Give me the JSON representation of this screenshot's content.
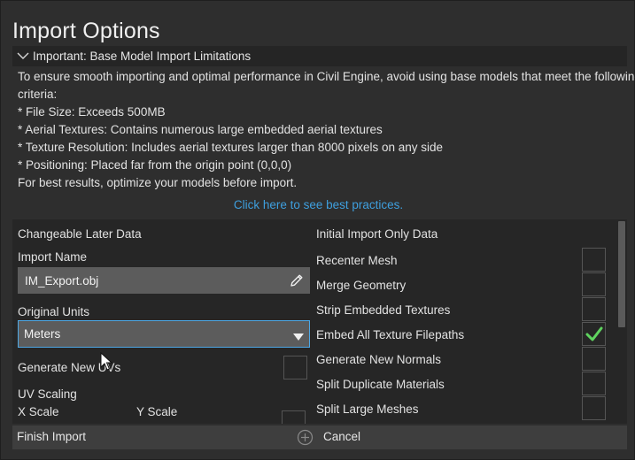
{
  "dialog": {
    "title": "Import Options"
  },
  "notice": {
    "header": "Important: Base Model Import Limitations",
    "lines": [
      "To ensure smooth importing and optimal performance in Civil Engine, avoid using base models that meet the following",
      "criteria:",
      "* File Size: Exceeds 500MB",
      "* Aerial Textures: Contains numerous large embedded aerial textures",
      "* Texture Resolution: Includes aerial textures larger than 8000 pixels on any side",
      "* Positioning: Placed far from the origin point (0,0,0)",
      "For best results, optimize your models before import."
    ],
    "link": "Click here to see best practices."
  },
  "left": {
    "section_title": "Changeable Later Data",
    "import_name_label": "Import Name",
    "import_name_value": "IM_Export.obj",
    "units_label": "Original Units",
    "units_value": "Meters",
    "generate_uvs_label": "Generate New UVs",
    "generate_uvs_checked": false,
    "uv_scaling_label": "UV Scaling",
    "x_scale_label": "X Scale",
    "y_scale_label": "Y Scale"
  },
  "right": {
    "section_title": "Initial Import Only Data",
    "options": [
      {
        "label": "Recenter Mesh",
        "checked": false
      },
      {
        "label": "Merge Geometry",
        "checked": false
      },
      {
        "label": "Strip Embedded Textures",
        "checked": false
      },
      {
        "label": "Embed All Texture Filepaths",
        "checked": true
      },
      {
        "label": "Generate New Normals",
        "checked": false
      },
      {
        "label": "Split Duplicate Materials",
        "checked": false
      },
      {
        "label": "Split Large Meshes",
        "checked": false
      }
    ]
  },
  "footer": {
    "finish_label": "Finish Import",
    "cancel_label": "Cancel"
  },
  "colors": {
    "accent": "#4ea8e6",
    "link": "#3e9fde",
    "check": "#5fd35f"
  }
}
